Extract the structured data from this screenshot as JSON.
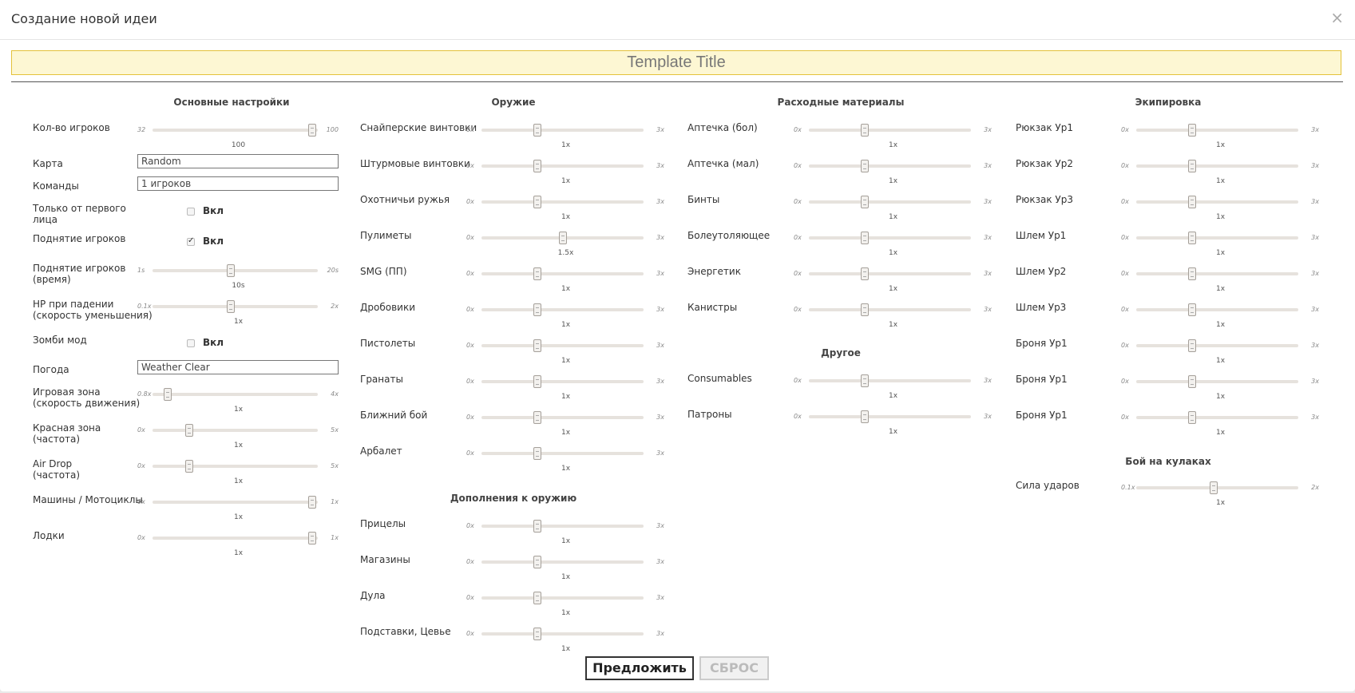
{
  "dialog": {
    "title": "Создание новой идеи",
    "close": "×"
  },
  "template_title": "Template Title",
  "columns": [
    {
      "sections": [
        {
          "title": "Основные настройки",
          "rows": [
            {
              "label": "Кол-во игроков",
              "type": "slider",
              "min": "32",
              "max": "100",
              "value": "100",
              "fraction": 1
            },
            {
              "label": "Карта",
              "type": "text",
              "value": "Random"
            },
            {
              "label": "Команды",
              "type": "text",
              "value": "1 игроков"
            },
            {
              "label": "Только от первого\nлица",
              "type": "checkbox",
              "checked": false,
              "text": "Вкл"
            },
            {
              "label": "Поднятие игроков",
              "type": "checkbox",
              "checked": true,
              "text": "Вкл"
            },
            {
              "label": "Поднятие игроков\n(время)",
              "type": "slider",
              "min": "1s",
              "max": "20s",
              "value": "10s",
              "fraction": 0.474
            },
            {
              "label": "HP при падении\n(скорость уменьшения)",
              "type": "slider",
              "min": "0.1x",
              "max": "2x",
              "value": "1x",
              "fraction": 0.474
            },
            {
              "label": "Зомби мод",
              "type": "checkbox",
              "checked": false,
              "text": "Вкл"
            },
            {
              "label": "Погода",
              "type": "text",
              "value": "Weather Clear"
            },
            {
              "label": "Игровая зона\n(скорость движения)",
              "type": "slider",
              "min": "0.8x",
              "max": "4x",
              "value": "1x",
              "fraction": 0.0625
            },
            {
              "label": "Красная зона\n(частота)",
              "type": "slider",
              "min": "0x",
              "max": "5x",
              "value": "1x",
              "fraction": 0.2
            },
            {
              "label": "Air Drop\n(частота)",
              "type": "slider",
              "min": "0x",
              "max": "5x",
              "value": "1x",
              "fraction": 0.2
            },
            {
              "label": "Машины / Мотоциклы",
              "type": "slider",
              "min": "0x",
              "max": "1x",
              "value": "1x",
              "fraction": 1
            },
            {
              "label": "Лодки",
              "type": "slider",
              "min": "0x",
              "max": "1x",
              "value": "1x",
              "fraction": 1
            }
          ]
        }
      ]
    },
    {
      "sections": [
        {
          "title": "Оружие",
          "rows": [
            {
              "label": "Снайперские винтовки",
              "type": "slider",
              "min": "0x",
              "max": "3x",
              "value": "1x",
              "fraction": 0.3333
            },
            {
              "label": "Штурмовые винтовки",
              "type": "slider",
              "min": "0x",
              "max": "3x",
              "value": "1x",
              "fraction": 0.3333
            },
            {
              "label": "Охотничьи ружья",
              "type": "slider",
              "min": "0x",
              "max": "3x",
              "value": "1x",
              "fraction": 0.3333
            },
            {
              "label": "Пулиметы",
              "type": "slider",
              "min": "0x",
              "max": "3x",
              "value": "1.5x",
              "fraction": 0.5
            },
            {
              "label": "SMG (ПП)",
              "type": "slider",
              "min": "0x",
              "max": "3x",
              "value": "1x",
              "fraction": 0.3333
            },
            {
              "label": "Дробовики",
              "type": "slider",
              "min": "0x",
              "max": "3x",
              "value": "1x",
              "fraction": 0.3333
            },
            {
              "label": "Пистолеты",
              "type": "slider",
              "min": "0x",
              "max": "3x",
              "value": "1x",
              "fraction": 0.3333
            },
            {
              "label": "Гранаты",
              "type": "slider",
              "min": "0x",
              "max": "3x",
              "value": "1x",
              "fraction": 0.3333
            },
            {
              "label": "Ближний бой",
              "type": "slider",
              "min": "0x",
              "max": "3x",
              "value": "1x",
              "fraction": 0.3333
            },
            {
              "label": "Арбалет",
              "type": "slider",
              "min": "0x",
              "max": "3x",
              "value": "1x",
              "fraction": 0.3333
            }
          ]
        },
        {
          "title": "Дополнения к оружию",
          "rows": [
            {
              "label": "Прицелы",
              "type": "slider",
              "min": "0x",
              "max": "3x",
              "value": "1x",
              "fraction": 0.3333
            },
            {
              "label": "Магазины",
              "type": "slider",
              "min": "0x",
              "max": "3x",
              "value": "1x",
              "fraction": 0.3333
            },
            {
              "label": "Дула",
              "type": "slider",
              "min": "0x",
              "max": "3x",
              "value": "1x",
              "fraction": 0.3333
            },
            {
              "label": "Подставки, Цевье",
              "type": "slider",
              "min": "0x",
              "max": "3x",
              "value": "1x",
              "fraction": 0.3333
            }
          ]
        }
      ]
    },
    {
      "sections": [
        {
          "title": "Расходные материалы",
          "rows": [
            {
              "label": "Аптечка (бол)",
              "type": "slider",
              "min": "0x",
              "max": "3x",
              "value": "1x",
              "fraction": 0.3333
            },
            {
              "label": "Аптечка (мал)",
              "type": "slider",
              "min": "0x",
              "max": "3x",
              "value": "1x",
              "fraction": 0.3333
            },
            {
              "label": "Бинты",
              "type": "slider",
              "min": "0x",
              "max": "3x",
              "value": "1x",
              "fraction": 0.3333
            },
            {
              "label": "Болеутоляющее",
              "type": "slider",
              "min": "0x",
              "max": "3x",
              "value": "1x",
              "fraction": 0.3333
            },
            {
              "label": "Энергетик",
              "type": "slider",
              "min": "0x",
              "max": "3x",
              "value": "1x",
              "fraction": 0.3333
            },
            {
              "label": "Канистры",
              "type": "slider",
              "min": "0x",
              "max": "3x",
              "value": "1x",
              "fraction": 0.3333
            }
          ]
        },
        {
          "title": "Другое",
          "rows": [
            {
              "label": "Consumables",
              "type": "slider",
              "min": "0x",
              "max": "3x",
              "value": "1x",
              "fraction": 0.3333
            },
            {
              "label": "Патроны",
              "type": "slider",
              "min": "0x",
              "max": "3x",
              "value": "1x",
              "fraction": 0.3333
            }
          ]
        }
      ]
    },
    {
      "sections": [
        {
          "title": "Экипировка",
          "rows": [
            {
              "label": "Рюкзак Ур1",
              "type": "slider",
              "min": "0x",
              "max": "3x",
              "value": "1x",
              "fraction": 0.3333
            },
            {
              "label": "Рюкзак Ур2",
              "type": "slider",
              "min": "0x",
              "max": "3x",
              "value": "1x",
              "fraction": 0.3333
            },
            {
              "label": "Рюкзак Ур3",
              "type": "slider",
              "min": "0x",
              "max": "3x",
              "value": "1x",
              "fraction": 0.3333
            },
            {
              "label": "Шлем Ур1",
              "type": "slider",
              "min": "0x",
              "max": "3x",
              "value": "1x",
              "fraction": 0.3333
            },
            {
              "label": "Шлем Ур2",
              "type": "slider",
              "min": "0x",
              "max": "3x",
              "value": "1x",
              "fraction": 0.3333
            },
            {
              "label": "Шлем Ур3",
              "type": "slider",
              "min": "0x",
              "max": "3x",
              "value": "1x",
              "fraction": 0.3333
            },
            {
              "label": "Броня Ур1",
              "type": "slider",
              "min": "0x",
              "max": "3x",
              "value": "1x",
              "fraction": 0.3333
            },
            {
              "label": "Броня Ур1",
              "type": "slider",
              "min": "0x",
              "max": "3x",
              "value": "1x",
              "fraction": 0.3333
            },
            {
              "label": "Броня Ур1",
              "type": "slider",
              "min": "0x",
              "max": "3x",
              "value": "1x",
              "fraction": 0.3333
            }
          ]
        },
        {
          "title": "Бой на кулаках",
          "rows": [
            {
              "label": "Сила ударов",
              "type": "slider",
              "min": "0.1x",
              "max": "2x",
              "value": "1x",
              "fraction": 0.474
            }
          ]
        }
      ]
    }
  ],
  "buttons": {
    "submit": "Предложить",
    "reset": "СБРОС"
  },
  "colors": {
    "title_bg": "#fdf7d3",
    "title_border": "#e4c23a",
    "track": "#e6e2dd"
  }
}
